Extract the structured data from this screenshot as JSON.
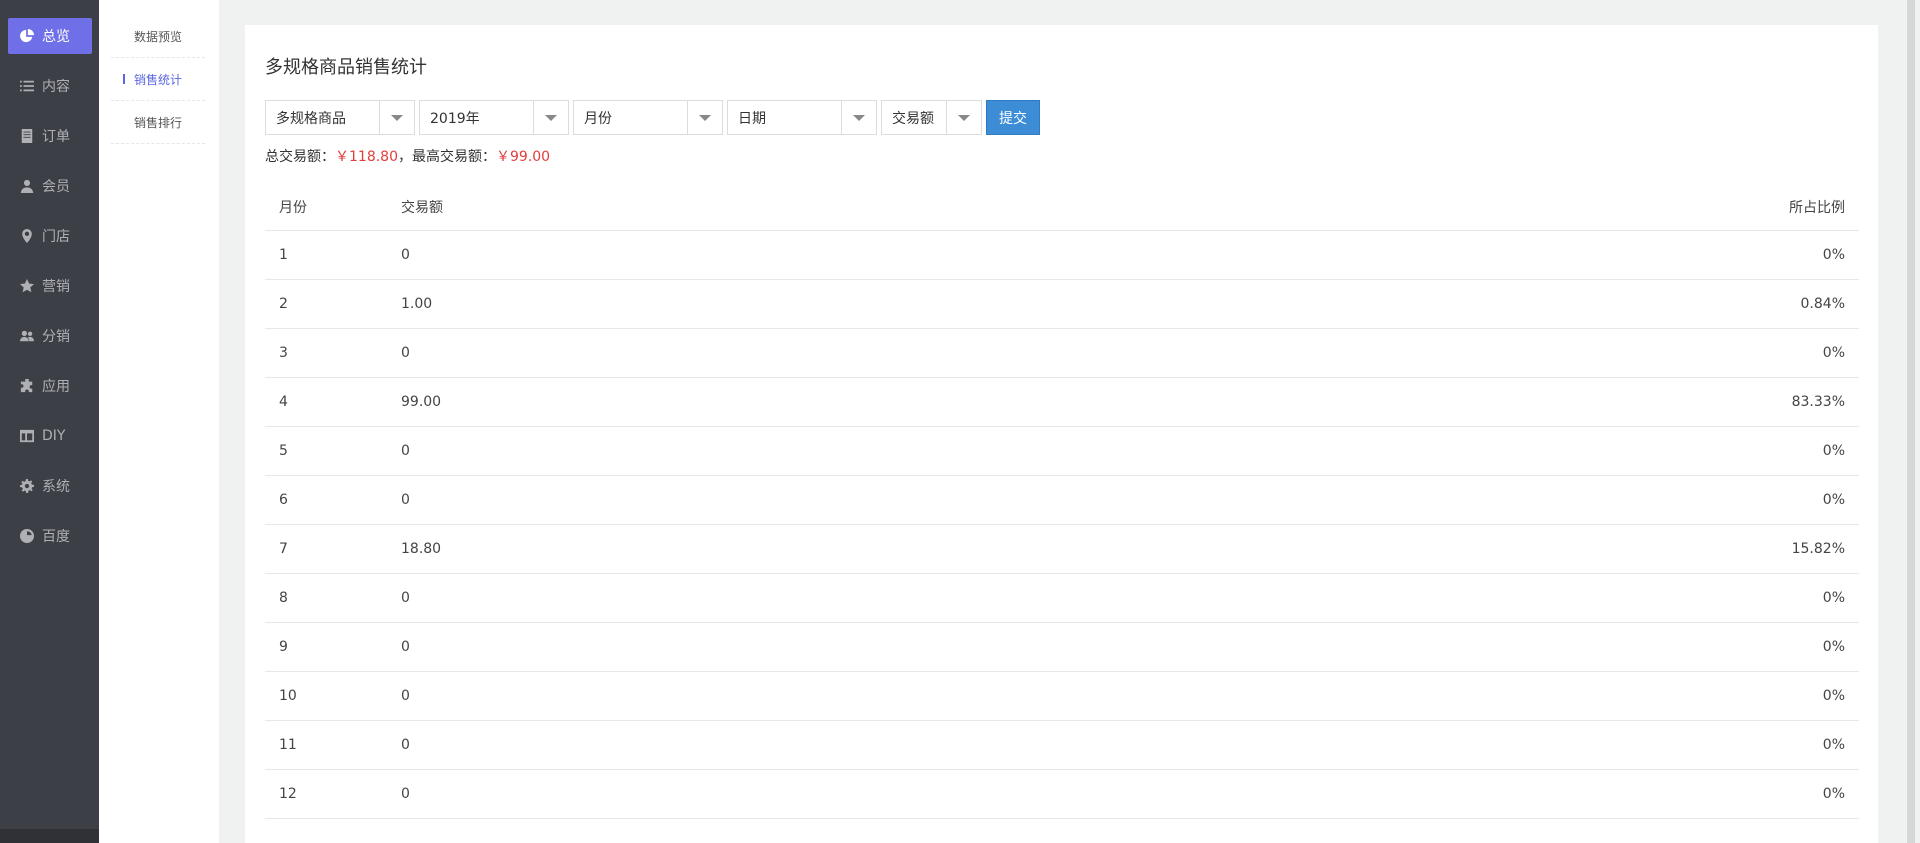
{
  "sidebar": {
    "items": [
      {
        "label": "总览",
        "icon": "pie-chart-icon",
        "active": true
      },
      {
        "label": "内容",
        "icon": "list-icon"
      },
      {
        "label": "订单",
        "icon": "document-icon"
      },
      {
        "label": "会员",
        "icon": "user-icon"
      },
      {
        "label": "门店",
        "icon": "map-pin-icon"
      },
      {
        "label": "营销",
        "icon": "star-icon"
      },
      {
        "label": "分销",
        "icon": "users-icon"
      },
      {
        "label": "应用",
        "icon": "puzzle-icon"
      },
      {
        "label": "DIY",
        "icon": "layout-icon"
      },
      {
        "label": "系统",
        "icon": "gear-icon"
      },
      {
        "label": "百度",
        "icon": "baidu-icon"
      }
    ]
  },
  "submenu": {
    "items": [
      {
        "label": "数据预览"
      },
      {
        "label": "销售统计",
        "active": true
      },
      {
        "label": "销售排行"
      }
    ]
  },
  "main": {
    "title": "多规格商品销售统计",
    "filters": {
      "product_type": "多规格商品",
      "year": "2019年",
      "month": "月份",
      "date": "日期",
      "metric": "交易额",
      "submit_label": "提交"
    },
    "summary": {
      "total_label": "总交易额：",
      "total_value": "￥118.80",
      "separator": "，",
      "max_label": "最高交易额：",
      "max_value": "￥99.00"
    },
    "table": {
      "headers": [
        "月份",
        "交易额",
        "所占比例"
      ],
      "rows": [
        [
          "1",
          "0",
          "0%"
        ],
        [
          "2",
          "1.00",
          "0.84%"
        ],
        [
          "3",
          "0",
          "0%"
        ],
        [
          "4",
          "99.00",
          "83.33%"
        ],
        [
          "5",
          "0",
          "0%"
        ],
        [
          "6",
          "0",
          "0%"
        ],
        [
          "7",
          "18.80",
          "15.82%"
        ],
        [
          "8",
          "0",
          "0%"
        ],
        [
          "9",
          "0",
          "0%"
        ],
        [
          "10",
          "0",
          "0%"
        ],
        [
          "11",
          "0",
          "0%"
        ],
        [
          "12",
          "0",
          "0%"
        ]
      ]
    }
  },
  "colors": {
    "sidebar_bg": "#3d3f46",
    "active_nav": "#6f6fe8",
    "submenu_active": "#5b66e0",
    "submit_button": "#3c8dd6",
    "highlight_red": "#e23c3c"
  }
}
